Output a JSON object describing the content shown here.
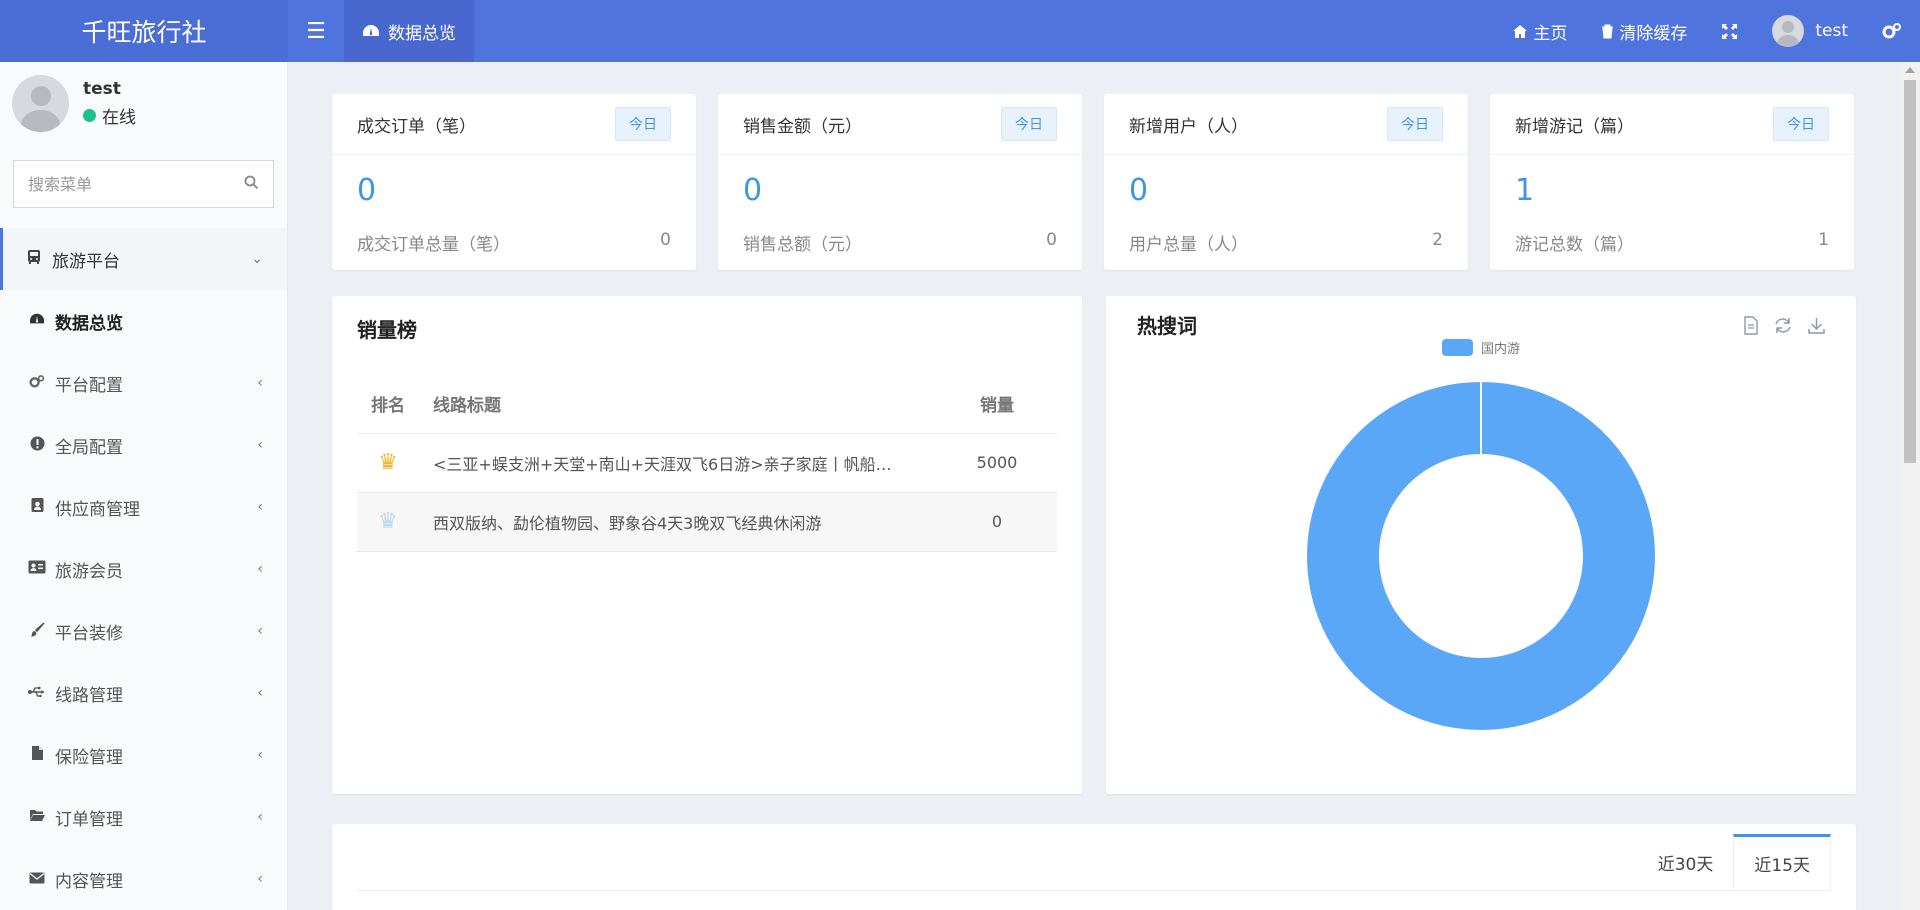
{
  "header": {
    "brand": "千旺旅行社",
    "menu_toggle_icon": "bars-icon",
    "active_tab": "数据总览",
    "home": "主页",
    "clear_cache": "清除缓存",
    "user": "test",
    "accent_color": "#4f74dd"
  },
  "sidebar": {
    "user_name": "test",
    "user_status": "在线",
    "search_placeholder": "搜索菜单",
    "items": [
      {
        "label": "旅游平台",
        "icon": "bus-icon"
      },
      {
        "label": "数据总览",
        "icon": "dashboard-icon"
      },
      {
        "label": "平台配置",
        "icon": "cogs-icon"
      },
      {
        "label": "全局配置",
        "icon": "exclamation-circle-icon"
      },
      {
        "label": "供应商管理",
        "icon": "id-badge-icon"
      },
      {
        "label": "旅游会员",
        "icon": "id-card-icon"
      },
      {
        "label": "平台装修",
        "icon": "paint-brush-icon"
      },
      {
        "label": "线路管理",
        "icon": "usb-icon"
      },
      {
        "label": "保险管理",
        "icon": "file-icon"
      },
      {
        "label": "订单管理",
        "icon": "folder-open-icon"
      },
      {
        "label": "内容管理",
        "icon": "envelope-icon"
      }
    ]
  },
  "stats": [
    {
      "title": "成交订单（笔）",
      "badge": "今日",
      "value": "0",
      "total_label": "成交订单总量（笔）",
      "total": "0"
    },
    {
      "title": "销售金额（元）",
      "badge": "今日",
      "value": "0",
      "total_label": "销售总额（元）",
      "total": "0"
    },
    {
      "title": "新增用户（人）",
      "badge": "今日",
      "value": "0",
      "total_label": "用户总量（人）",
      "total": "2"
    },
    {
      "title": "新增游记（篇）",
      "badge": "今日",
      "value": "1",
      "total_label": "游记总数（篇）",
      "total": "1"
    }
  ],
  "ranking": {
    "title": "销量榜",
    "headers": {
      "rank": "排名",
      "route": "线路标题",
      "sales": "销量"
    },
    "rows": [
      {
        "route": "<三亚+蜈支洲+天堂+南山+天涯双飞6日游>亲子家庭丨帆船…",
        "sales": "5000",
        "crown": "gold"
      },
      {
        "route": "西双版纳、勐伦植物园、野象谷4天3晚双飞经典休闲游",
        "sales": "0",
        "crown": "blue"
      }
    ]
  },
  "hot_search": {
    "title": "热搜词",
    "tools": [
      "file-text-icon",
      "refresh-icon",
      "download-icon"
    ]
  },
  "chart_data": {
    "type": "pie",
    "donut": true,
    "categories": [
      "国内游"
    ],
    "values": [
      1
    ],
    "colors": [
      "#5aa7f8"
    ],
    "legend": "top-center"
  },
  "bottom_tabs": [
    "近30天",
    "近15天"
  ]
}
